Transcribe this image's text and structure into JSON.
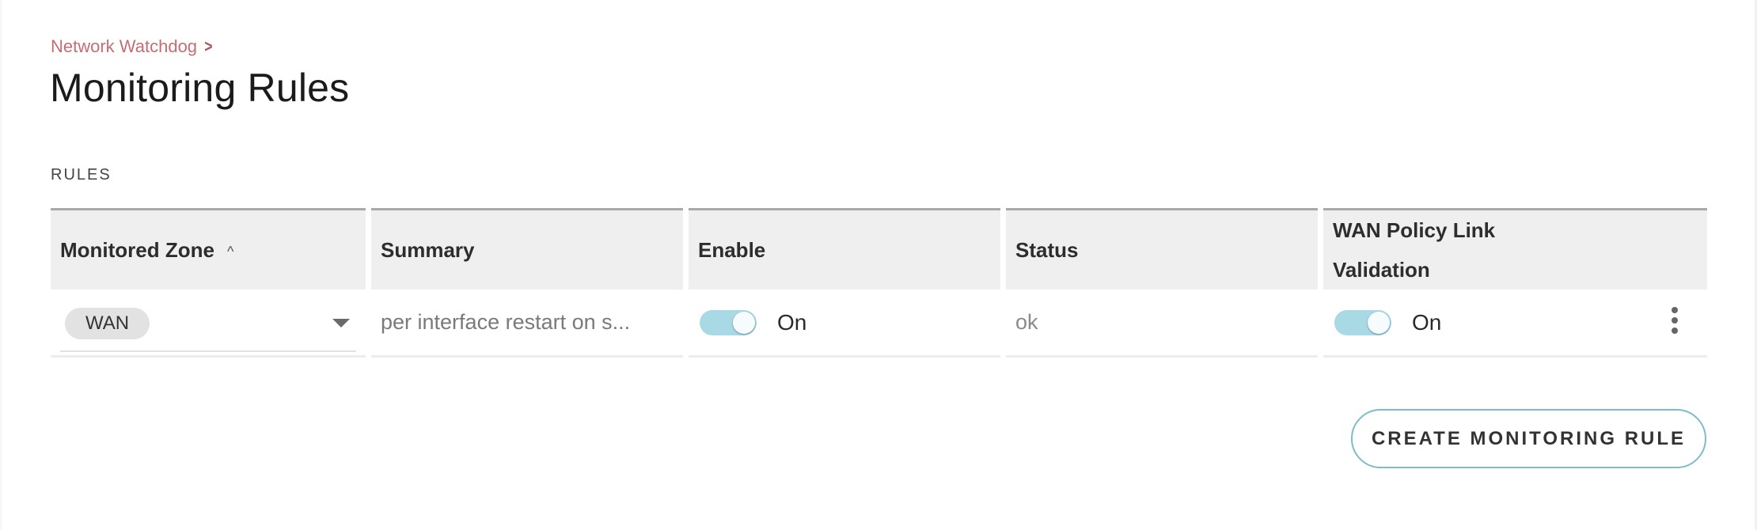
{
  "breadcrumb": {
    "parent": "Network Watchdog",
    "separator_icon": "chevron-right-icon"
  },
  "page_title": "Monitoring Rules",
  "section_label": "RULES",
  "table": {
    "columns": [
      {
        "label": "Monitored Zone",
        "sort": "ascending",
        "sort_icon": "caret-up-icon"
      },
      {
        "label": "Summary"
      },
      {
        "label": "Enable"
      },
      {
        "label": "Status"
      },
      {
        "label_line1": "WAN Policy Link",
        "label_line2": "Validation"
      }
    ],
    "rows": [
      {
        "zone": "WAN",
        "summary": "per interface restart on s...",
        "enable": {
          "state": true,
          "label": "On"
        },
        "status": "ok",
        "wan_policy_link_validation": {
          "state": true,
          "label": "On"
        },
        "actions_icon": "more-vertical-icon"
      }
    ]
  },
  "create_button_label": "CREATE MONITORING RULE",
  "colors": {
    "breadcrumb": "#c46d73",
    "toggle_on": "#a9d9e4",
    "button_border": "#7fbcc8",
    "header_bg": "#efefef"
  }
}
